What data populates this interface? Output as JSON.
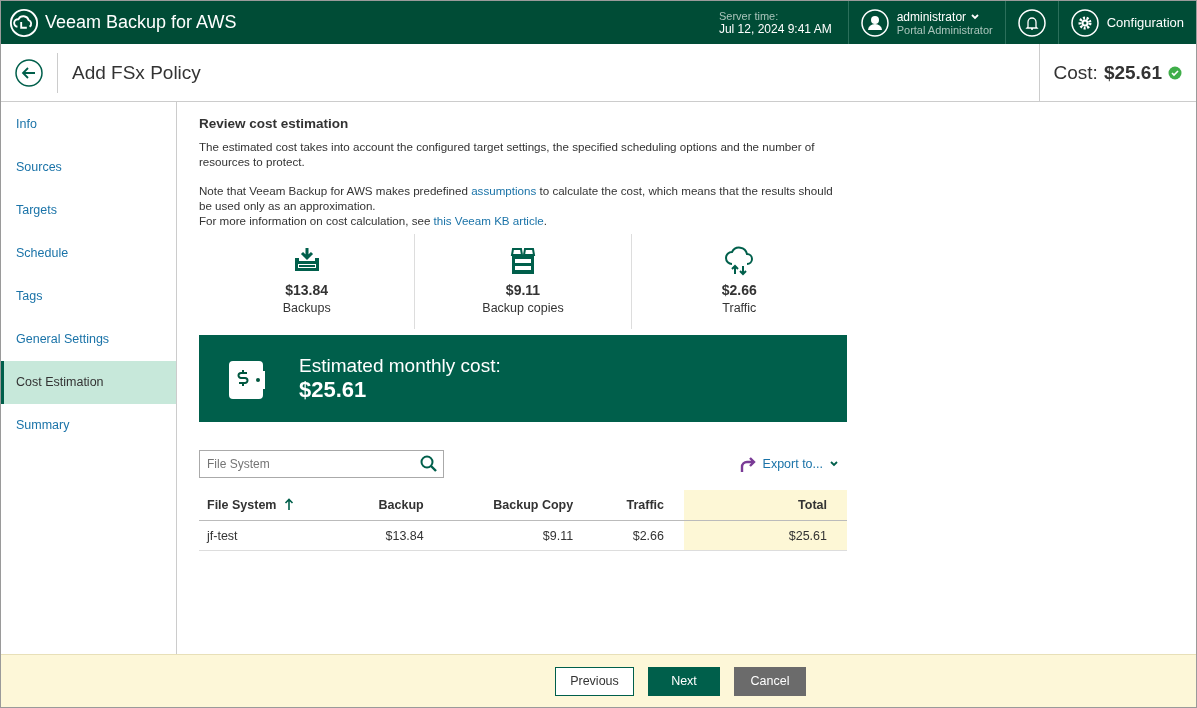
{
  "app": {
    "title": "Veeam Backup for AWS",
    "server_time_label": "Server time:",
    "server_time": "Jul 12, 2024 9:41 AM",
    "user_name": "administrator",
    "user_role": "Portal Administrator",
    "configuration": "Configuration"
  },
  "page": {
    "title": "Add FSx Policy",
    "cost_label": "Cost:",
    "cost_value": "$25.61"
  },
  "sidebar": {
    "items": [
      {
        "label": "Info",
        "selected": false
      },
      {
        "label": "Sources",
        "selected": false
      },
      {
        "label": "Targets",
        "selected": false
      },
      {
        "label": "Schedule",
        "selected": false
      },
      {
        "label": "Tags",
        "selected": false
      },
      {
        "label": "General Settings",
        "selected": false
      },
      {
        "label": "Cost Estimation",
        "selected": true
      },
      {
        "label": "Summary",
        "selected": false
      }
    ]
  },
  "content": {
    "heading": "Review cost estimation",
    "paragraphs": [
      [
        {
          "text": "The estimated cost takes into account the configured target settings, the specified scheduling options and the number of resources to protect."
        }
      ],
      [
        {
          "text": "Note that Veeam Backup for AWS makes predefined "
        },
        {
          "link": "assumptions"
        },
        {
          "text": " to calculate the cost, which means that the results should be used only as an approximation."
        }
      ],
      [
        {
          "text": "For more information on cost calculation, see "
        },
        {
          "link": "this Veeam KB article"
        },
        {
          "text": "."
        }
      ]
    ],
    "summary": [
      {
        "kind": "backups",
        "value": "$13.84",
        "label": "Backups"
      },
      {
        "kind": "copies",
        "value": "$9.11",
        "label": "Backup copies"
      },
      {
        "kind": "traffic",
        "value": "$2.66",
        "label": "Traffic"
      }
    ],
    "monthly": {
      "label": "Estimated monthly cost:",
      "value": "$25.61"
    },
    "search": {
      "placeholder": "File System"
    },
    "export": "Export to...",
    "table": {
      "columns": [
        {
          "label": "File System",
          "sorted": true,
          "highlighted": false,
          "kind": "name"
        },
        {
          "label": "Backup",
          "sorted": false,
          "highlighted": false,
          "kind": "amount"
        },
        {
          "label": "Backup Copy",
          "sorted": false,
          "highlighted": false,
          "kind": "amount"
        },
        {
          "label": "Traffic",
          "sorted": false,
          "highlighted": false,
          "kind": "amount"
        },
        {
          "label": "Total",
          "sorted": false,
          "highlighted": true,
          "kind": "amount"
        }
      ],
      "rows": [
        [
          "jf-test",
          "$13.84",
          "$9.11",
          "$2.66",
          "$25.61"
        ]
      ]
    }
  },
  "footer": {
    "buttons": [
      {
        "label": "Previous",
        "kind": "outline"
      },
      {
        "label": "Next",
        "kind": "primary"
      },
      {
        "label": "Cancel",
        "kind": "secondary"
      }
    ]
  }
}
